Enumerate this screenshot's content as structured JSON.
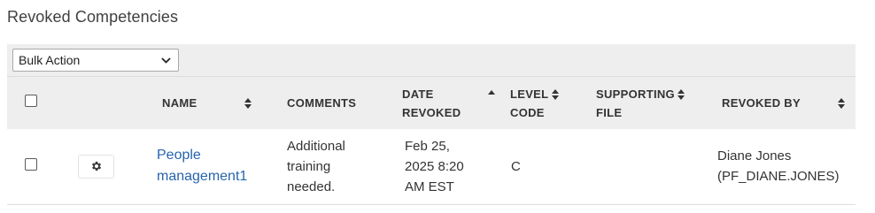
{
  "page": {
    "title": "Revoked Competencies"
  },
  "toolbar": {
    "bulk_action": "Bulk Action"
  },
  "columns": {
    "name": "NAME",
    "comments": "COMMENTS",
    "date_revoked_1": "DATE",
    "date_revoked_2": "REVOKED",
    "level_code_1": "LEVEL",
    "level_code_2": "CODE",
    "supporting_file_1": "SUPPORTING",
    "supporting_file_2": "FILE",
    "revoked_by": "REVOKED BY"
  },
  "rows": [
    {
      "name_1": "People",
      "name_2": "management1",
      "comments_1": "Additional",
      "comments_2": "training",
      "comments_3": "needed.",
      "date_1": "Feb 25,",
      "date_2": "2025 8:20",
      "date_3": "AM EST",
      "level_code": "C",
      "supporting_file": "",
      "revoked_by_1": "Diane Jones",
      "revoked_by_2": "(PF_DIANE.JONES)"
    }
  ],
  "colors": {
    "link": "#2765ac",
    "header_bg": "#eeeeee"
  }
}
